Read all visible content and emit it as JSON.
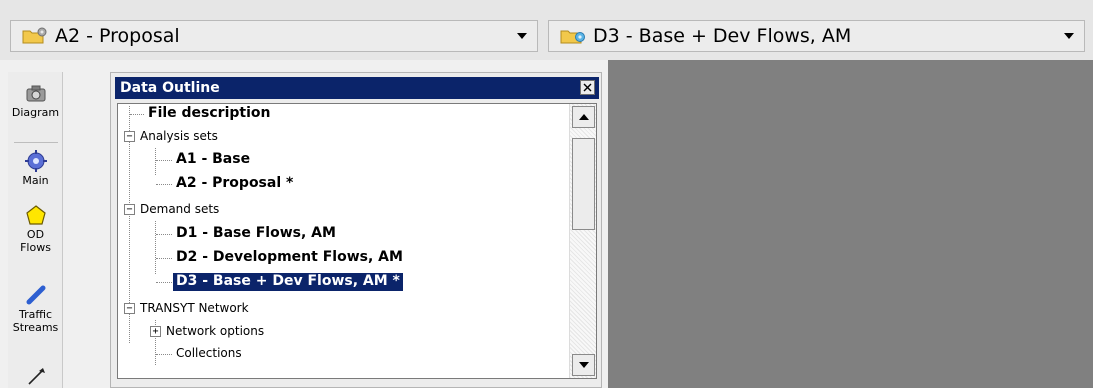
{
  "selectors": {
    "analysis": {
      "label": "A2 - Proposal",
      "icon": "folder-gear-icon"
    },
    "demand": {
      "label": "D3 - Base + Dev Flows, AM",
      "icon": "folder-gear-icon"
    }
  },
  "toolbar": {
    "items": [
      {
        "label": "Diagram",
        "icon": "camera-icon"
      },
      {
        "label": "Main",
        "icon": "gear-icon"
      },
      {
        "label_line1": "OD",
        "label_line2": "Flows",
        "icon": "pentagon-icon"
      },
      {
        "label_line1": "Traffic",
        "label_line2": "Streams",
        "icon": "pencil-icon"
      },
      {
        "icon": "line-icon"
      }
    ]
  },
  "panel": {
    "title": "Data Outline",
    "close_icon": "close-icon",
    "tree": {
      "file_description": "File description",
      "analysis_sets": "Analysis sets",
      "a1": "A1 - Base",
      "a2": "A2 - Proposal *",
      "demand_sets": "Demand sets",
      "d1": "D1 - Base Flows, AM",
      "d2": "D2 - Development Flows, AM",
      "d3": "D3 - Base + Dev Flows, AM *",
      "transyt_network": "TRANSYT Network",
      "network_options": "Network options",
      "collections": "Collections",
      "collapse_glyph": "−",
      "expand_glyph": "+"
    }
  },
  "colors": {
    "title_bar": "#0b246a",
    "workspace": "#808080",
    "selection": "#0b246a"
  }
}
